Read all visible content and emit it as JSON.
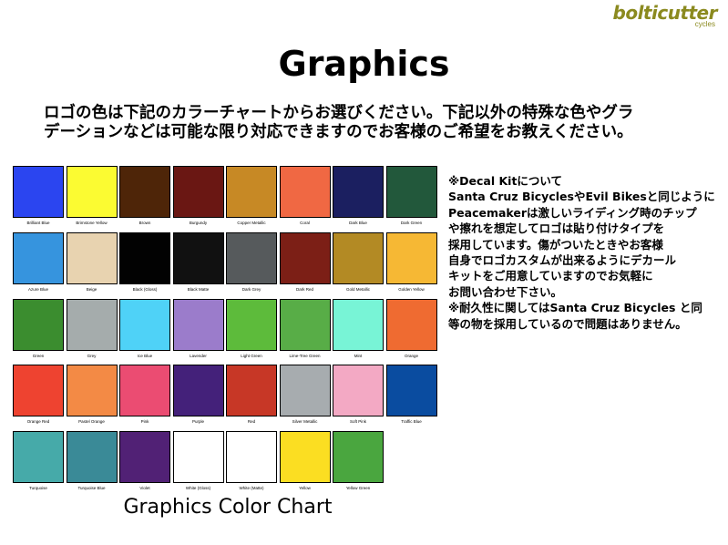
{
  "logo": {
    "brand": "bolticutter",
    "sub": "cycles"
  },
  "title": "Graphics",
  "intro": [
    "ロゴの色は下記のカラーチャートからお選びください。下記以外の特殊な色やグラ",
    "デーションなどは可能な限り対応できますのでお客様のご希望をお教えください。"
  ],
  "colors": [
    {
      "name": "Brilliant Blue",
      "hex": "#2b45f0"
    },
    {
      "name": "Brimstone Yellow",
      "hex": "#fbfb32"
    },
    {
      "name": "Brown",
      "hex": "#4e2508"
    },
    {
      "name": "Burgundy",
      "hex": "#6a1713"
    },
    {
      "name": "Copper Metallic",
      "hex": "#c78925"
    },
    {
      "name": "Coral",
      "hex": "#f06843"
    },
    {
      "name": "Dark Blue",
      "hex": "#1b1f60"
    },
    {
      "name": "Dark Green",
      "hex": "#22583b"
    },
    {
      "name": "Azure Blue",
      "hex": "#3694de"
    },
    {
      "name": "Beige",
      "hex": "#e8d3b0"
    },
    {
      "name": "Black (Gloss)",
      "hex": "#020202"
    },
    {
      "name": "Black Matte",
      "hex": "#111111"
    },
    {
      "name": "Dark Grey",
      "hex": "#565a5c"
    },
    {
      "name": "Dark Red",
      "hex": "#7c1f16"
    },
    {
      "name": "Gold Metallic",
      "hex": "#b38a24"
    },
    {
      "name": "Golden Yellow",
      "hex": "#f6b834"
    },
    {
      "name": "Green",
      "hex": "#3b8d2f"
    },
    {
      "name": "Grey",
      "hex": "#a5acac"
    },
    {
      "name": "Ice Blue",
      "hex": "#4fd2f7"
    },
    {
      "name": "Lavender",
      "hex": "#9b7ccb"
    },
    {
      "name": "Light Green",
      "hex": "#5dbb3b"
    },
    {
      "name": "Lime-Tree Green",
      "hex": "#58ad47"
    },
    {
      "name": "Mint",
      "hex": "#78f4d6"
    },
    {
      "name": "Orange",
      "hex": "#ef6b31"
    },
    {
      "name": "Orange Red",
      "hex": "#ee4330"
    },
    {
      "name": "Pastel Orange",
      "hex": "#f38a45"
    },
    {
      "name": "Pink",
      "hex": "#eb4c72"
    },
    {
      "name": "Purple",
      "hex": "#44217a"
    },
    {
      "name": "Red",
      "hex": "#c73726"
    },
    {
      "name": "Silver Metallic",
      "hex": "#a7acaf"
    },
    {
      "name": "Soft Pink",
      "hex": "#f3a9c4"
    },
    {
      "name": "Traffic Blue",
      "hex": "#0a4ca0"
    },
    {
      "name": "Turquoise",
      "hex": "#46aaa9"
    },
    {
      "name": "Turquoise Blue",
      "hex": "#3a8a97"
    },
    {
      "name": "Violet",
      "hex": "#512175"
    },
    {
      "name": "White (Gloss)",
      "hex": "#ffffff"
    },
    {
      "name": "White (Matte)",
      "hex": "#ffffff"
    },
    {
      "name": "Yellow",
      "hex": "#fbde22"
    },
    {
      "name": "Yellow Green",
      "hex": "#4aa63f"
    }
  ],
  "chart_caption": "Graphics Color Chart",
  "note": [
    "※Decal Kitについて",
    "Santa Cruz BicyclesやEvil Bikesと同じように",
    "Peacemakerは激しいライディング時のチップ",
    "や擦れを想定してロゴは貼り付けタイプを",
    "採用しています。傷がついたときやお客様",
    "自身でロゴカスタムが出来るようにデカール",
    "キットをご用意していますのでお気軽に",
    "お問い合わせ下さい。",
    "※耐久性に関してはSanta Cruz Bicycles と同",
    "等の物を採用しているので問題はありません。"
  ]
}
